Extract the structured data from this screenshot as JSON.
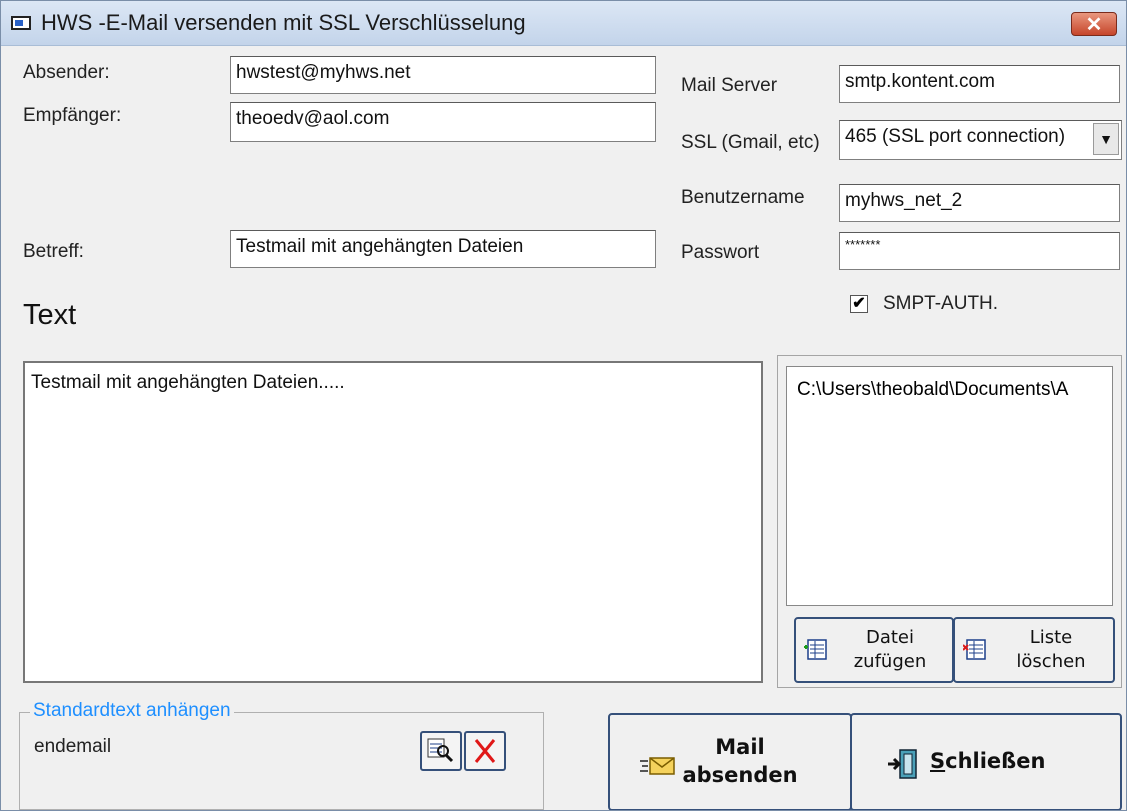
{
  "window": {
    "title": "HWS -E-Mail versenden mit SSL Verschlüsselung",
    "close_label": "✕"
  },
  "form": {
    "sender_label": "Absender:",
    "sender_value": "hwstest@myhws.net",
    "recipient_label": "Empfänger:",
    "recipient_value": "theoedv@aol.com",
    "subject_label": "Betreff:",
    "subject_value": "Testmail mit angehängten Dateien",
    "text_heading": "Text",
    "body_text": "Testmail mit angehängten Dateien....."
  },
  "server": {
    "mail_server_label": "Mail Server",
    "mail_server_value": "smtp.kontent.com",
    "ssl_label": "SSL (Gmail, etc)",
    "ssl_value": "465 (SSL port connection)",
    "username_label": "Benutzername",
    "username_value": "myhws_net_2",
    "password_label": "Passwort",
    "password_value": "*******",
    "auth_label": "SMPT-AUTH.",
    "auth_checked": true
  },
  "attachments": {
    "files": [
      "C:\\Users\\theobald\\Documents\\A"
    ],
    "add_label_1": "Datei",
    "add_label_2": "zufügen",
    "clear_label_1": "Liste",
    "clear_label_2": "löschen"
  },
  "standard_text": {
    "legend": "Standardtext anhängen",
    "value": "endemail"
  },
  "actions": {
    "send_label_1": "Mail",
    "send_label_2": "absenden",
    "close_label_prefix": "S",
    "close_label_rest": "chließen"
  },
  "colors": {
    "legend_blue": "#1e8fff",
    "button_border": "#35507a",
    "close_red": "#c6452a"
  }
}
